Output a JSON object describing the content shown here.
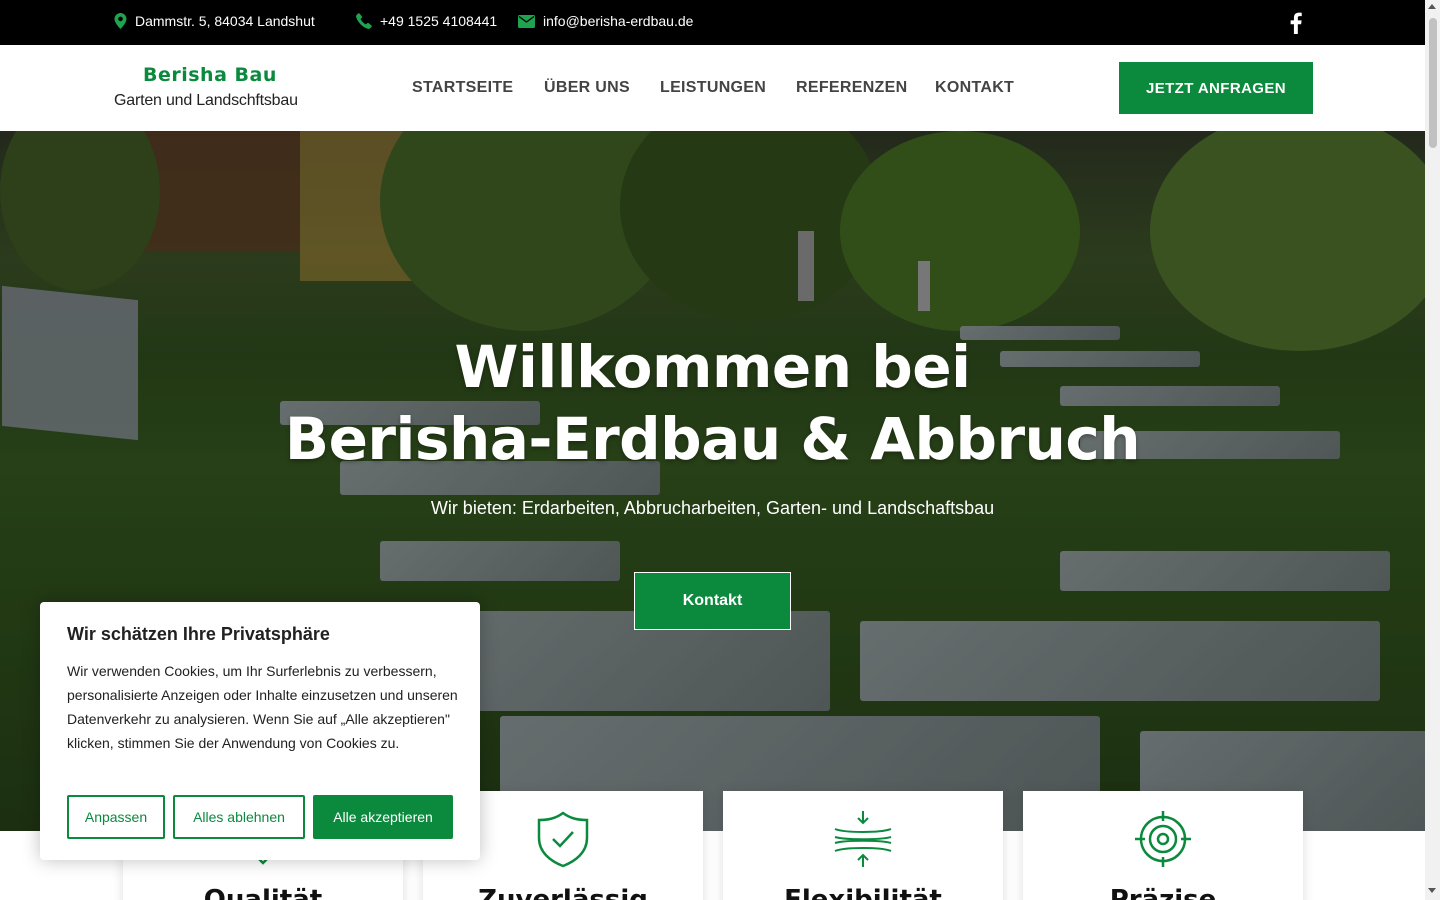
{
  "topbar": {
    "address": "Dammstr. 5, 84034 Landshut",
    "phone": "+49 1525 4108441",
    "email": "info@berisha-erdbau.de",
    "icons": [
      "map-pin-icon",
      "phone-icon",
      "envelope-icon",
      "facebook-icon"
    ]
  },
  "header": {
    "logo_title": "Berisha Bau",
    "logo_subtitle": "Garten und Landschftsbau",
    "nav": [
      "STARTSEITE",
      "ÜBER UNS",
      "LEISTUNGEN",
      "REFERENZEN",
      "KONTAKT"
    ],
    "cta_label": "JETZT ANFRAGEN"
  },
  "hero": {
    "title_line1": "Willkommen bei",
    "title_line2": "Berisha-Erdbau & Abbruch",
    "subtitle": "Wir bieten: Erdarbeiten, Abbrucharbeiten, Garten- und Landschaftsbau",
    "button_label": "Kontakt"
  },
  "features": [
    {
      "title": "Qualität",
      "icon": "badge-icon"
    },
    {
      "title": "Zuverlässig",
      "icon": "shield-check-icon"
    },
    {
      "title": "Flexibilität",
      "icon": "compress-arrows-icon"
    },
    {
      "title": "Präzise",
      "icon": "target-icon"
    }
  ],
  "cookie": {
    "title": "Wir schätzen Ihre Privatsphäre",
    "text": "Wir verwenden Cookies, um Ihr Surferlebnis zu verbessern, personalisierte Anzeigen oder Inhalte einzusetzen und unseren Datenverkehr zu analysieren. Wenn Sie auf „Alle akzeptieren\" klicken, stimmen Sie der Anwendung von Cookies zu.",
    "btn_customize": "Anpassen",
    "btn_reject": "Alles ablehnen",
    "btn_accept": "Alle akzeptieren"
  },
  "colors": {
    "brand_green": "#0b8a3e",
    "topbar_bg": "#000000",
    "nav_text": "#444444"
  }
}
